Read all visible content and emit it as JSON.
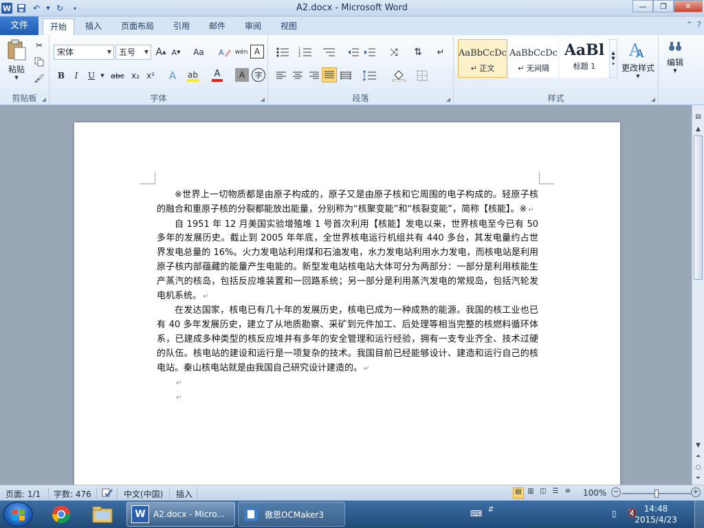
{
  "window": {
    "title": "A2.docx - Microsoft Word",
    "app_logo": "W",
    "minimize": "—",
    "maximize": "❐",
    "close": "✕"
  },
  "tabs": [
    {
      "label": "文件"
    },
    {
      "label": "开始"
    },
    {
      "label": "插入"
    },
    {
      "label": "页面布局"
    },
    {
      "label": "引用"
    },
    {
      "label": "邮件"
    },
    {
      "label": "审阅"
    },
    {
      "label": "视图"
    }
  ],
  "ribbon": {
    "clipboard": {
      "label": "剪贴板",
      "paste": "粘贴"
    },
    "font": {
      "label": "字体",
      "font_name": "宋体",
      "font_size": "五号",
      "grow": "A",
      "shrink": "A",
      "change_case": "Aa",
      "bold": "B",
      "italic": "I",
      "underline": "U",
      "strike": "abc",
      "subscript": "x₂",
      "superscript": "x²",
      "text_effect": "A",
      "font_color": "A",
      "char_shading": "A",
      "enclose": "字",
      "phonetic": "wén",
      "char_border": "A"
    },
    "paragraph": {
      "label": "段落"
    },
    "styles": {
      "label": "样式",
      "items": [
        {
          "sample": "AaBbCcDc",
          "name": "↵ 正文"
        },
        {
          "sample": "AaBbCcDc",
          "name": "↵ 无间隔"
        },
        {
          "sample": "AaBl",
          "name": "标题 1"
        }
      ],
      "change_styles": "更改样式"
    },
    "editing": {
      "label": "编辑"
    }
  },
  "document": {
    "paragraphs": [
      "※世界上一切物质都是由原子构成的，原子又是由原子核和它周围的电子构成的。轻原子核的融合和重原子核的分裂都能放出能量，分别称为“核聚变能”和“核裂变能”，简称【核能】。※",
      "自 1951 年 12 月美国实验增殖堆 1 号首次利用【核能】发电以来，世界核电至今已有 50 多年的发展历史。截止到 2005 年年底，全世界核电运行机组共有 440 多台，其发电量约占世界发电总量的 16%。火力发电站利用煤和石油发电，水力发电站利用水力发电，而核电站是利用原子核内部蕴藏的能量产生电能的。新型发电站核电站大体可分为两部分：一部分是利用核能生产蒸汽的核岛，包括反应堆装置和一回路系统；另一部分是利用蒸汽发电的常规岛，包括汽轮发电机系统。",
      "在发达国家，核电已有几十年的发展历史，核电已成为一种成熟的能源。我国的核工业也已有 40 多年发展历史，建立了从地质勘察、采矿到元件加工、后处理等相当完整的核燃料循环体系，已建成多种类型的核反应堆并有多年的安全管理和运行经验，拥有一支专业齐全、技术过硬的队伍。核电站的建设和运行是一项复杂的技术。我国目前已经能够设计、建造和运行自己的核电站。秦山核电站就是由我国自己研究设计建造的。"
    ],
    "paragraph_mark": "↵"
  },
  "statusbar": {
    "page": "页面: 1/1",
    "words": "字数: 476",
    "language": "中文(中国)",
    "mode": "插入",
    "zoom": "100%",
    "zoom_fraction": 0.5
  },
  "taskbar": {
    "tasks": [
      {
        "label": "A2.docx - Micro..."
      },
      {
        "label": "傲思OCMaker3"
      }
    ],
    "time": "14:48",
    "date": "2015/4/23"
  },
  "colors": {
    "accent": "#2b5fad",
    "font_color_bar": "#e3241b",
    "highlight_bar": "#f5e83a",
    "start_orb": "#1f5fb8"
  }
}
